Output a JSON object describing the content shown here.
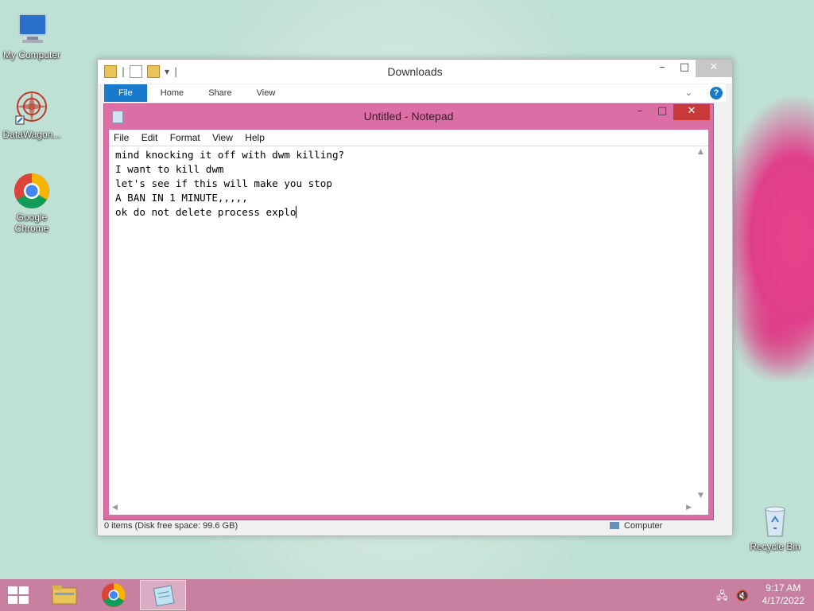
{
  "desktop": {
    "icons": [
      {
        "label": "My Computer"
      },
      {
        "label": "DataWagon..."
      },
      {
        "label": "Google Chrome"
      },
      {
        "label": "Recycle Bin"
      }
    ]
  },
  "explorer": {
    "title": "Downloads",
    "ribbon_tabs": [
      "File",
      "Home",
      "Share",
      "View"
    ],
    "status_left": "0 items (Disk free space: 99.6 GB)",
    "status_right": "Computer"
  },
  "notepad": {
    "title": "Untitled - Notepad",
    "menu": [
      "File",
      "Edit",
      "Format",
      "View",
      "Help"
    ],
    "lines": [
      "mind knocking it off with dwm killing?",
      "I want to kill dwm",
      "let's see if this will make you stop",
      "A BAN IN 1 MINUTE,,,,,",
      "ok do not delete process explo"
    ]
  },
  "taskbar": {
    "time": "9:17 AM",
    "date": "4/17/2022"
  },
  "colors": {
    "notepad_frame": "#dc6ea6",
    "close_red": "#c8393a",
    "ribbon_blue": "#1979ca"
  }
}
